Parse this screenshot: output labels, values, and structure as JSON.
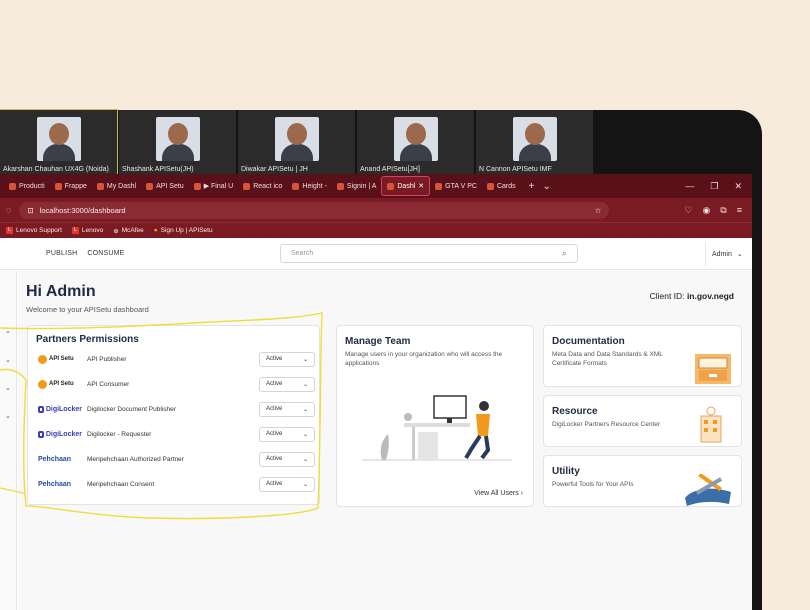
{
  "video_participants": [
    {
      "name": "Akarshan Chauhan UX4G (Noida)",
      "active": true
    },
    {
      "name": "Shashank APISetu(JH)"
    },
    {
      "name": "Diwakar APISetu | JH"
    },
    {
      "name": "Anand APISetu[JH]"
    },
    {
      "name": "N Cannon APISetu IMF"
    }
  ],
  "browser": {
    "tabs": [
      "Producti",
      "Frappe",
      "My Dashl",
      "API Setu",
      "▶ Final U",
      "React ico",
      "Height -",
      "Signin | A",
      "Dashl",
      "GTA V PC",
      "Cards"
    ],
    "active_tab": 8,
    "url": "localhost:3000/dashboard",
    "bookmarks": [
      "Lenovo Support",
      "Lenovo",
      "McAfee",
      "Sign Up | APISetu"
    ]
  },
  "header": {
    "nav": [
      "PUBLISH",
      "CONSUME"
    ],
    "search_placeholder": "Search",
    "user": "Admin"
  },
  "page": {
    "greeting": "Hi Admin",
    "welcome": "Welcome to your APISetu dashboard",
    "client_label": "Client ID:",
    "client_id": "in.gov.negd"
  },
  "partners": {
    "title": "Partners Permissions",
    "rows": [
      {
        "logo": "API Setu",
        "name": "API Publisher",
        "status": "Active"
      },
      {
        "logo": "API Setu",
        "name": "API Consumer",
        "status": "Active"
      },
      {
        "logo": "DigiLocker",
        "name": "Digilocker Document Publisher",
        "status": "Active"
      },
      {
        "logo": "DigiLocker",
        "name": "Digilocker - Requester",
        "status": "Active"
      },
      {
        "logo": "Pehchaan",
        "name": "Meripehchaan Authorized Partner",
        "status": "Active"
      },
      {
        "logo": "Pehchaan",
        "name": "Meripehchaan Consent",
        "status": "Active"
      }
    ]
  },
  "manage_team": {
    "title": "Manage Team",
    "desc": "Manage users in your organization who will access the applications",
    "link": "View All Users"
  },
  "documentation": {
    "title": "Documentation",
    "desc": "Meta Data and Data Standards & XML Certificate Formats"
  },
  "resource": {
    "title": "Resource",
    "desc": "DigiLocker Partners Resource Center"
  },
  "utility": {
    "title": "Utility",
    "desc": "Powerful Tools for Your APIs"
  },
  "colors": {
    "browser_chrome": "#7a1a22",
    "annotation": "#f0dc3c",
    "accent": "#f29a1b"
  }
}
